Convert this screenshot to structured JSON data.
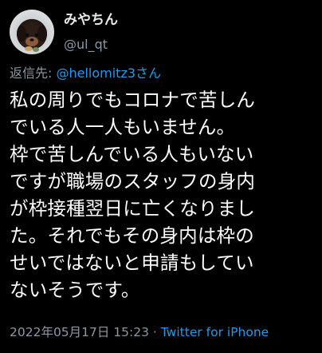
{
  "author": {
    "display_name": "みやちん",
    "handle": "@ul_qt",
    "avatar_icon": "dog-avatar-icon"
  },
  "reply": {
    "prefix": "返信先: ",
    "mention": "@hellomitz3さん"
  },
  "tweet": {
    "text": "私の周りでもコロナで苦しん\nでいる人一人もいません。\n枠で苦しんでいる人もいない\nですが職場のスタッフの身内\nが枠接種翌日に亡くなりまし\nた。それでもその身内は枠の\nせいではないと申請もしてい\nないそうです。"
  },
  "meta": {
    "timestamp": "2022年05月17日 15:23",
    "separator": " · ",
    "source": "Twitter for iPhone"
  },
  "colors": {
    "background": "#000000",
    "text": "#ffffff",
    "secondary": "#8b98a5",
    "link": "#1d9bf0"
  }
}
